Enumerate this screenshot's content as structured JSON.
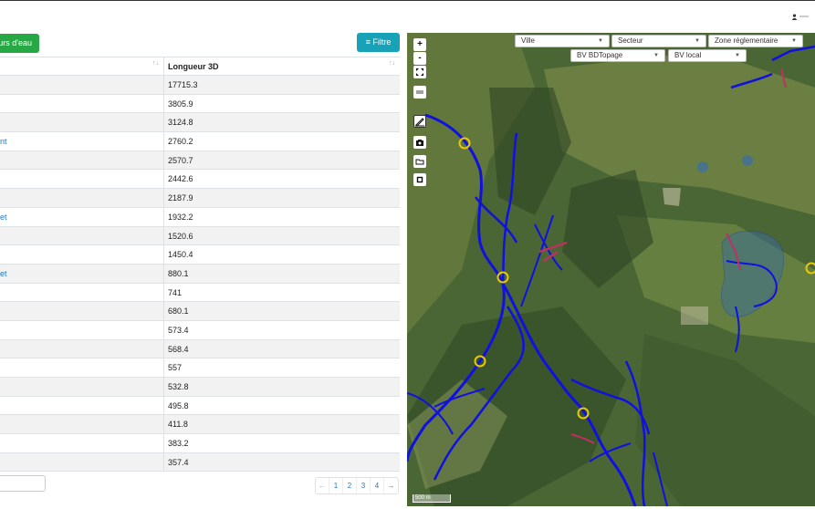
{
  "toolbar": {
    "add_label": "urs d'eau",
    "filter_label": "≡ Filtre"
  },
  "table": {
    "header_col2": "Longueur 3D",
    "rows": [
      {
        "name": "",
        "length": "17715.3"
      },
      {
        "name": "",
        "length": "3805.9"
      },
      {
        "name": "",
        "length": "3124.8"
      },
      {
        "name": "nt",
        "length": "2760.2"
      },
      {
        "name": "",
        "length": "2570.7"
      },
      {
        "name": "",
        "length": "2442.6"
      },
      {
        "name": "",
        "length": "2187.9"
      },
      {
        "name": "et",
        "length": "1932.2"
      },
      {
        "name": "",
        "length": "1520.6"
      },
      {
        "name": "",
        "length": "1450.4"
      },
      {
        "name": "et",
        "length": "880.1"
      },
      {
        "name": "",
        "length": "741"
      },
      {
        "name": "",
        "length": "680.1"
      },
      {
        "name": "",
        "length": "573.4"
      },
      {
        "name": "",
        "length": "568.4"
      },
      {
        "name": "",
        "length": "557"
      },
      {
        "name": "",
        "length": "532.8"
      },
      {
        "name": "",
        "length": "495.8"
      },
      {
        "name": "",
        "length": "411.8"
      },
      {
        "name": "",
        "length": "383.2"
      },
      {
        "name": "",
        "length": "357.4"
      }
    ]
  },
  "pager": {
    "prev": "←",
    "pages": [
      "1",
      "2",
      "3",
      "4"
    ],
    "next": "→"
  },
  "map": {
    "filters": {
      "ville": "Ville",
      "secteur": "Secteur",
      "zone": "Zone réglementaire",
      "bv_bdtopage": "BV BDTopage",
      "bv_local": "BV local"
    },
    "controls": {
      "zoom_in": "+",
      "zoom_out": "-"
    },
    "scale_label": "500 m"
  },
  "colors": {
    "river": "#1010e0",
    "accent_green": "#28a745",
    "accent_teal": "#17a2b8",
    "link": "#1e7bc6"
  }
}
